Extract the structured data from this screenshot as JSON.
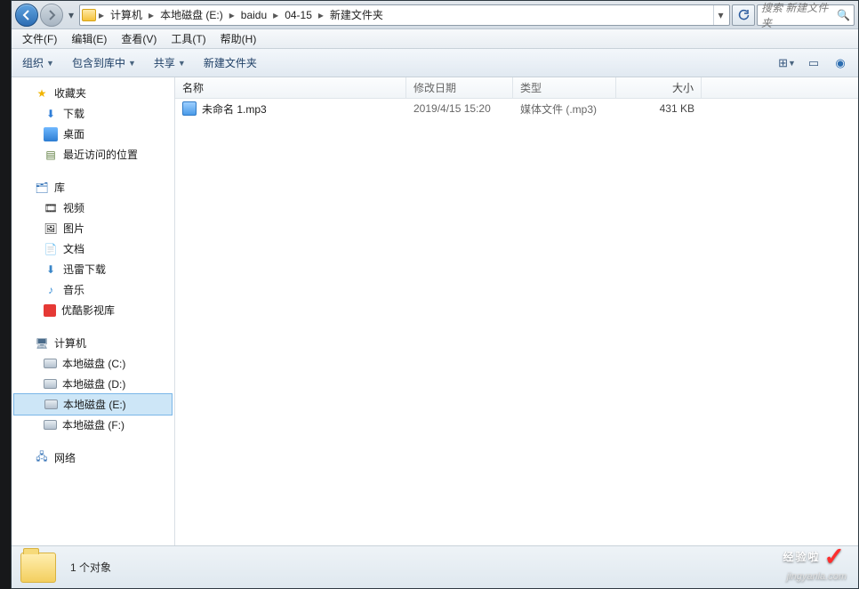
{
  "breadcrumb": [
    "计算机",
    "本地磁盘 (E:)",
    "baidu",
    "04-15",
    "新建文件夹"
  ],
  "search_placeholder": "搜索 新建文件夹",
  "menus": {
    "file": "文件(F)",
    "edit": "编辑(E)",
    "view": "查看(V)",
    "tools": "工具(T)",
    "help": "帮助(H)"
  },
  "toolbar": {
    "organize": "组织",
    "include": "包含到库中",
    "share": "共享",
    "newfolder": "新建文件夹"
  },
  "sidebar": {
    "favorites": {
      "label": "收藏夹",
      "items": [
        {
          "label": "下载",
          "icon": "download"
        },
        {
          "label": "桌面",
          "icon": "desktop"
        },
        {
          "label": "最近访问的位置",
          "icon": "recent"
        }
      ]
    },
    "libraries": {
      "label": "库",
      "items": [
        {
          "label": "视频",
          "icon": "video"
        },
        {
          "label": "图片",
          "icon": "picture"
        },
        {
          "label": "文档",
          "icon": "document"
        },
        {
          "label": "迅雷下载",
          "icon": "xunlei"
        },
        {
          "label": "音乐",
          "icon": "music"
        },
        {
          "label": "优酷影视库",
          "icon": "youku"
        }
      ]
    },
    "computer": {
      "label": "计算机",
      "items": [
        {
          "label": "本地磁盘 (C:)",
          "icon": "drive"
        },
        {
          "label": "本地磁盘 (D:)",
          "icon": "drive"
        },
        {
          "label": "本地磁盘 (E:)",
          "icon": "drive",
          "selected": true
        },
        {
          "label": "本地磁盘 (F:)",
          "icon": "drive"
        }
      ]
    },
    "network": {
      "label": "网络"
    }
  },
  "columns": {
    "name": "名称",
    "date": "修改日期",
    "type": "类型",
    "size": "大小"
  },
  "files": [
    {
      "name": "未命名 1.mp3",
      "date": "2019/4/15 15:20",
      "type": "媒体文件 (.mp3)",
      "size": "431 KB"
    }
  ],
  "status": {
    "count": "1 个对象"
  },
  "watermark": {
    "text": "经验啦",
    "url": "jingyanla.com"
  }
}
